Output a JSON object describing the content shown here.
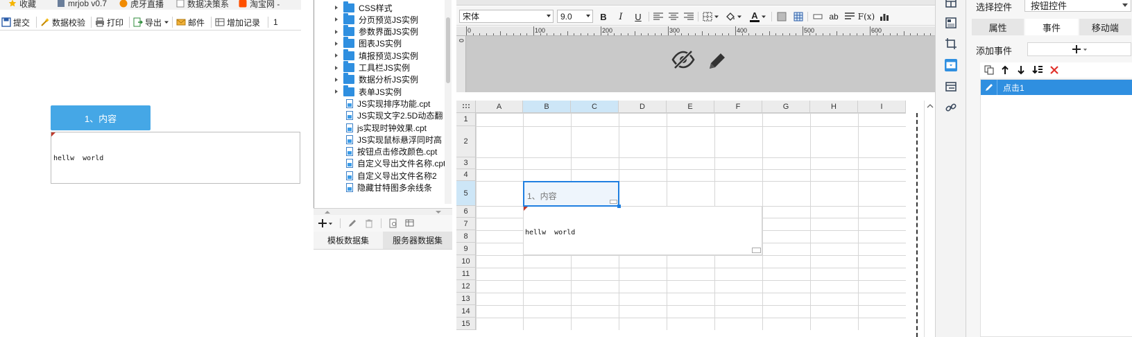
{
  "browser": {
    "bookmarks": [
      {
        "label": "收藏",
        "icon": "star-icon"
      },
      {
        "label": "mrjob v0.7",
        "icon": "doc-icon"
      },
      {
        "label": "虎牙直播",
        "icon": "tiger-icon"
      },
      {
        "label": "数据决策系",
        "icon": "page-icon"
      },
      {
        "label": "淘宝网 -",
        "icon": "taobao-icon"
      }
    ]
  },
  "report_toolbar": {
    "submit": "提交",
    "validate": "数据校验",
    "print": "打印",
    "export": "导出",
    "mail": "邮件",
    "add_record": "增加记录",
    "page_indicator": "1"
  },
  "preview": {
    "tab_label": "1、内容",
    "content_text": "hellw  world"
  },
  "tree": {
    "folders": [
      "CSS样式",
      "分页预览JS实例",
      "参数界面JS实例",
      "图表JS实例",
      "填报预览JS实例",
      "工具栏JS实例",
      "数据分析JS实例",
      "表单JS实例"
    ],
    "files": [
      "JS实现排序功能.cpt",
      "JS实现文字2.5D动态翻",
      "js实现时钟效果.cpt",
      "JS实现鼠标悬浮同时高",
      "按钮点击修改颜色.cpt",
      "自定义导出文件名称.cpt",
      "自定义导出文件名称2",
      "隐藏甘特图多余线条"
    ]
  },
  "datasets": {
    "tabs": [
      "模板数据集",
      "服务器数据集"
    ],
    "active_tab": 1
  },
  "format_toolbar": {
    "font_family": "宋体",
    "font_size": "9.0",
    "bold": "B",
    "italic": "I",
    "underline": "U",
    "text_color_glyph": "A",
    "abbr": "ab",
    "fx": "F(x)"
  },
  "ruler": {
    "labels": [
      "0",
      "100",
      "200",
      "300",
      "400",
      "500",
      "600"
    ],
    "vertical_label": "0"
  },
  "sheet": {
    "columns": [
      "A",
      "B",
      "C",
      "D",
      "E",
      "F",
      "G",
      "H",
      "I"
    ],
    "selected_columns": [
      "B",
      "C"
    ],
    "rows": [
      "1",
      "2",
      "3",
      "4",
      "5",
      "6",
      "7",
      "8",
      "9",
      "10",
      "11",
      "12",
      "13",
      "14",
      "15"
    ],
    "selected_row": "5",
    "cell_b5_text": "1、内容",
    "merged_cell_text": "hellw  world"
  },
  "properties": {
    "select_control_label": "选择控件",
    "selected_control": "按钮控件",
    "tabs": [
      "属性",
      "事件",
      "移动端"
    ],
    "active_tab": 1,
    "add_event_label": "添加事件",
    "events": [
      "点击1"
    ]
  },
  "colors": {
    "accent": "#2f8fe0",
    "preview_tab": "#45a7e6",
    "selection_fill": "#cde6f7",
    "delete_red": "#e0302a"
  }
}
